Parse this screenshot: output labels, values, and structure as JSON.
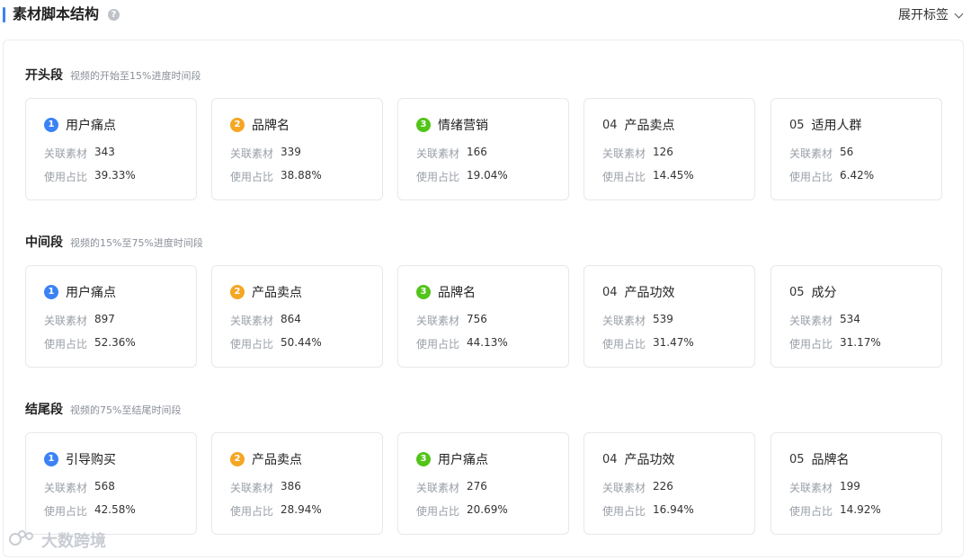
{
  "header": {
    "title": "素材脚本结构",
    "help_icon": "question-icon",
    "expand_label": "展开标签",
    "accent_color": "#3b82f6"
  },
  "badge_colors": {
    "1": "#3b82f6",
    "2": "#f5a623",
    "3": "#52c41a"
  },
  "labels": {
    "related": "关联素材",
    "ratio": "使用占比"
  },
  "sections": [
    {
      "name": "开头段",
      "desc": "视频的开始至15%进度时间段",
      "cards": [
        {
          "rank": "1",
          "title": "用户痛点",
          "related": "343",
          "ratio": "39.33%"
        },
        {
          "rank": "2",
          "title": "品牌名",
          "related": "339",
          "ratio": "38.88%"
        },
        {
          "rank": "3",
          "title": "情绪营销",
          "related": "166",
          "ratio": "19.04%"
        },
        {
          "rank": "04",
          "title": "产品卖点",
          "related": "126",
          "ratio": "14.45%"
        },
        {
          "rank": "05",
          "title": "适用人群",
          "related": "56",
          "ratio": "6.42%"
        }
      ]
    },
    {
      "name": "中间段",
      "desc": "视频的15%至75%进度时间段",
      "cards": [
        {
          "rank": "1",
          "title": "用户痛点",
          "related": "897",
          "ratio": "52.36%"
        },
        {
          "rank": "2",
          "title": "产品卖点",
          "related": "864",
          "ratio": "50.44%"
        },
        {
          "rank": "3",
          "title": "品牌名",
          "related": "756",
          "ratio": "44.13%"
        },
        {
          "rank": "04",
          "title": "产品功效",
          "related": "539",
          "ratio": "31.47%"
        },
        {
          "rank": "05",
          "title": "成分",
          "related": "534",
          "ratio": "31.17%"
        }
      ]
    },
    {
      "name": "结尾段",
      "desc": "视频的75%至结尾时间段",
      "cards": [
        {
          "rank": "1",
          "title": "引导购买",
          "related": "568",
          "ratio": "42.58%"
        },
        {
          "rank": "2",
          "title": "产品卖点",
          "related": "386",
          "ratio": "28.94%"
        },
        {
          "rank": "3",
          "title": "用户痛点",
          "related": "276",
          "ratio": "20.69%"
        },
        {
          "rank": "04",
          "title": "产品功效",
          "related": "226",
          "ratio": "16.94%"
        },
        {
          "rank": "05",
          "title": "品牌名",
          "related": "199",
          "ratio": "14.92%"
        }
      ]
    }
  ],
  "watermark": {
    "text": "大数跨境",
    "icon": "logo-icon"
  }
}
